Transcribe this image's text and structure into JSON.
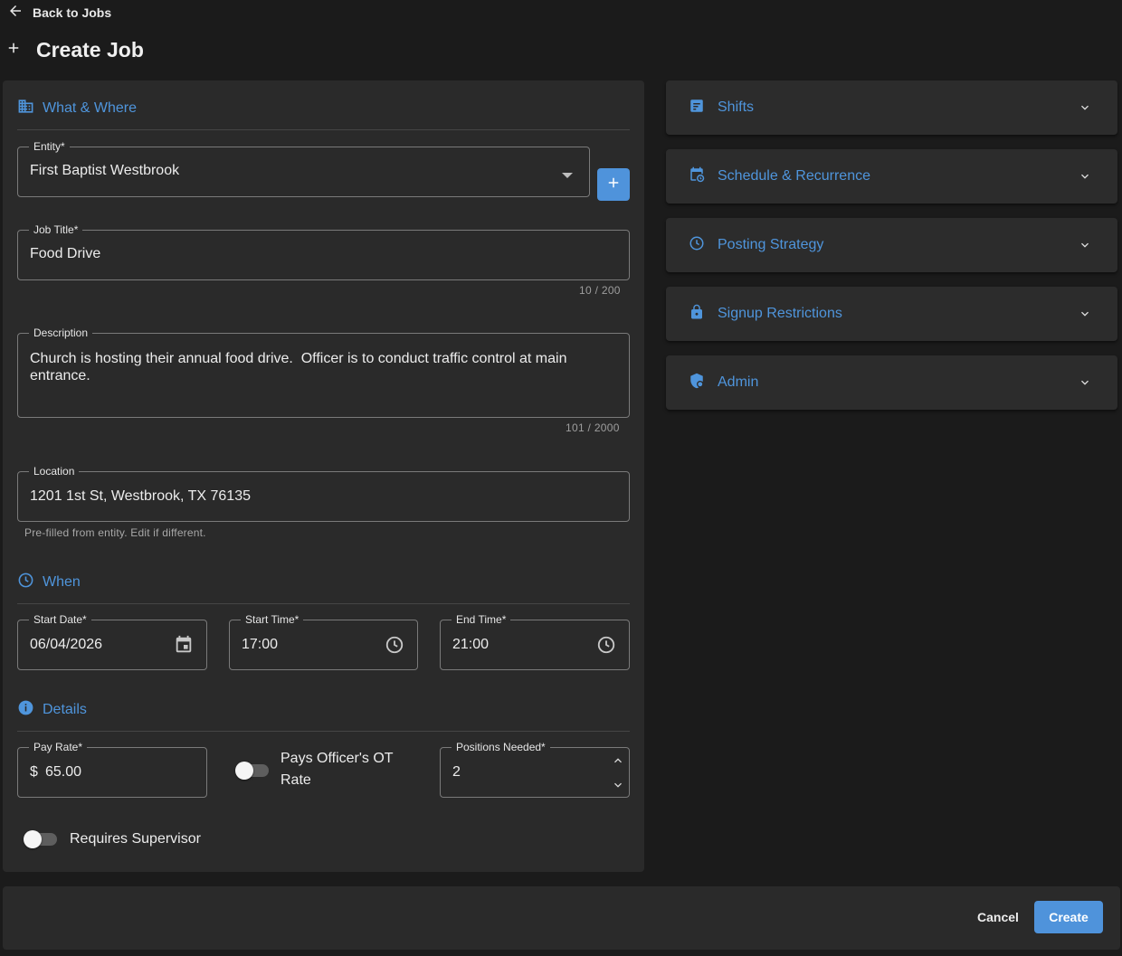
{
  "nav": {
    "back_label": "Back to Jobs"
  },
  "page": {
    "title": "Create Job"
  },
  "what_where": {
    "heading": "What & Where",
    "entity": {
      "label": "Entity*",
      "value": "First Baptist Westbrook"
    },
    "job_title": {
      "label": "Job Title*",
      "value": "Food Drive",
      "counter": "10 / 200"
    },
    "description": {
      "label": "Description",
      "value": "Church is hosting their annual food drive.  Officer is to conduct traffic control at main entrance.",
      "counter": "101 / 2000"
    },
    "location": {
      "label": "Location",
      "value": "1201 1st St, Westbrook, TX 76135",
      "hint": "Pre-filled from entity. Edit if different."
    }
  },
  "when": {
    "heading": "When",
    "start_date": {
      "label": "Start Date*",
      "value": "06/04/2026"
    },
    "start_time": {
      "label": "Start Time*",
      "value": "17:00"
    },
    "end_time": {
      "label": "End Time*",
      "value": "21:00"
    }
  },
  "details": {
    "heading": "Details",
    "pay_rate": {
      "label": "Pay Rate*",
      "prefix": "$",
      "value": "65.00"
    },
    "ot_toggle": {
      "label_line1": "Pays Officer's OT",
      "label_line2": "Rate",
      "on": false
    },
    "positions": {
      "label": "Positions Needed*",
      "value": "2"
    },
    "supervisor_toggle": {
      "label": "Requires Supervisor",
      "on": false
    }
  },
  "accordions": [
    {
      "title": "Shifts",
      "icon": "shifts-icon"
    },
    {
      "title": "Schedule & Recurrence",
      "icon": "calendar-clock-icon"
    },
    {
      "title": "Posting Strategy",
      "icon": "clock-icon"
    },
    {
      "title": "Signup Restrictions",
      "icon": "lock-icon"
    },
    {
      "title": "Admin",
      "icon": "shield-icon"
    }
  ],
  "footer": {
    "cancel_label": "Cancel",
    "create_label": "Create"
  },
  "colors": {
    "accent": "#4f93db",
    "background": "#1b1b1b",
    "card": "#2a2a2a"
  }
}
